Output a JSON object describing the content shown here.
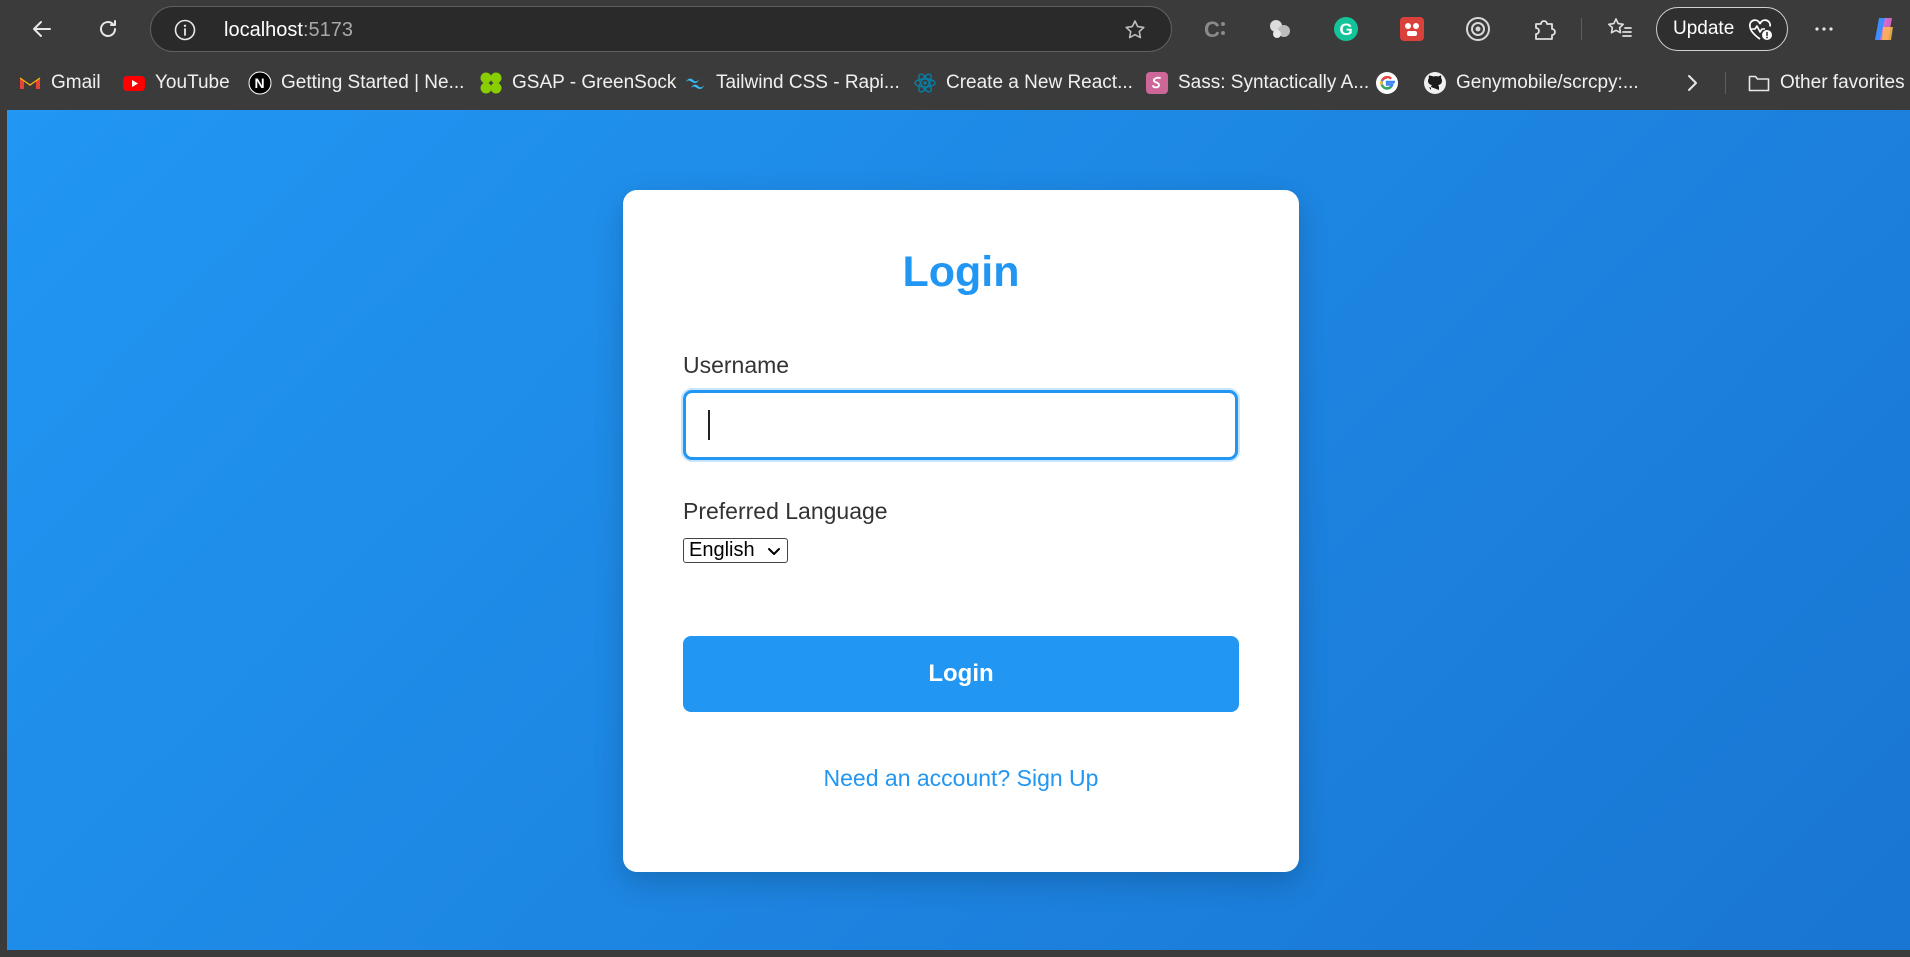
{
  "browser": {
    "url_host": "localhost",
    "url_port": ":5173",
    "update_label": "Update",
    "bookmarks": [
      {
        "label": "Gmail",
        "icon": "gmail-icon"
      },
      {
        "label": "YouTube",
        "icon": "youtube-icon"
      },
      {
        "label": "Getting Started | Ne...",
        "icon": "nextjs-icon"
      },
      {
        "label": "GSAP - GreenSock",
        "icon": "gsap-icon"
      },
      {
        "label": "Tailwind CSS - Rapi...",
        "icon": "tailwind-icon"
      },
      {
        "label": "Create a New React...",
        "icon": "react-icon"
      },
      {
        "label": "Sass: Syntactically A...",
        "icon": "sass-icon"
      },
      {
        "label": "",
        "icon": "google-icon"
      },
      {
        "label": "Genymobile/scrcpy:...",
        "icon": "github-icon"
      }
    ],
    "other_favorites": "Other favorites"
  },
  "login": {
    "title": "Login",
    "username_label": "Username",
    "username_value": "",
    "language_label": "Preferred Language",
    "language_selected": "English",
    "submit_label": "Login",
    "signup_link": "Need an account? Sign Up"
  },
  "colors": {
    "primary": "#2196f3",
    "chrome_bg": "#3b3b3b"
  }
}
